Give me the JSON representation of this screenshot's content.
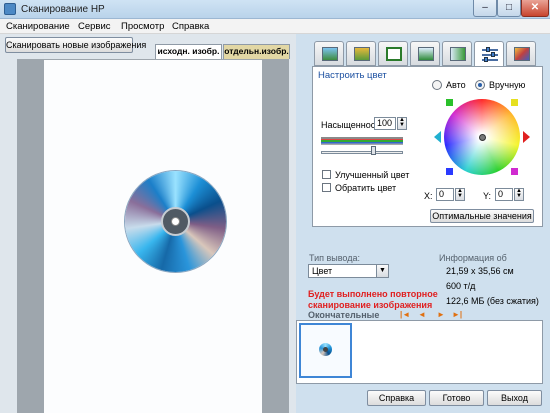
{
  "window": {
    "title": "Сканирование HP",
    "minimize": "–",
    "maximize": "□",
    "close": "✕"
  },
  "menu": [
    "Сканирование",
    "Сервис",
    "Просмотр",
    "Справка"
  ],
  "left": {
    "scan_new_button": "Сканировать новые изображения",
    "tabs": [
      "исходн. изобр.",
      "отдельн.изобр."
    ]
  },
  "toolbar_icons": [
    "scan-preview-icon",
    "copy-icon",
    "crop-icon",
    "resize-icon",
    "output-icon",
    "color-adjust-icon",
    "tools-icon"
  ],
  "color": {
    "title": "Настроить цвет",
    "auto_label": "Авто",
    "manual_label": "Вручную",
    "saturation_label": "Насыщенност",
    "saturation_value": "100",
    "enhanced_label": "Улучшенный цвет",
    "invert_label": "Обратить цвет",
    "x_label": "X:",
    "x_value": "0",
    "y_label": "Y:",
    "y_value": "0",
    "optimal_button": "Оптимальные значения"
  },
  "output": {
    "type_label": "Тип вывода:",
    "type_value": "Цвет",
    "info_title": "Информация об",
    "dimensions": "21,59 x 35,56 см",
    "resolution": "600 т/д",
    "size": "122,6 МБ (без сжатия)",
    "rescan_notice": "Будет выполнено повторное сканирование изображения",
    "final_label": "Окончательные"
  },
  "nav_arrows": [
    "|◄",
    "◄",
    "►",
    "►|"
  ],
  "buttons": {
    "help": "Справка",
    "done": "Готово",
    "exit": "Выход"
  },
  "colors": {
    "accent": "#1b4fa0",
    "warning": "#e02020",
    "selection": "#3f86d6"
  }
}
